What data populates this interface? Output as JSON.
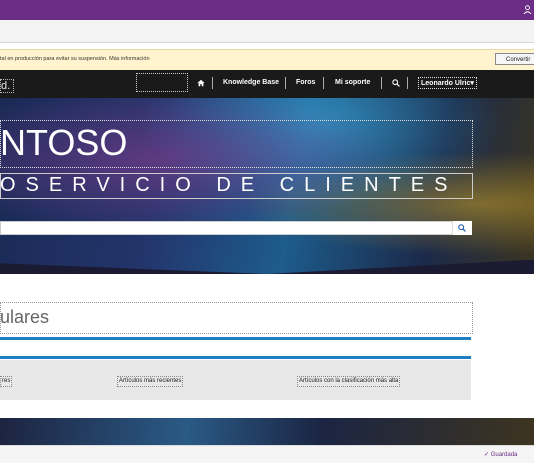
{
  "warning": {
    "message": "tal en producción para evitar su suspensión. Más información",
    "button_label": "Convertir"
  },
  "nav": {
    "logo_text": "d.",
    "items": [
      "Knowledge Base",
      "Foros",
      "Mi soporte"
    ],
    "user_label": "Leonardo Ulric▾"
  },
  "hero": {
    "title": "NTOSO",
    "subtitle": "OSERVICIO DE CLIENTES",
    "search_placeholder": ""
  },
  "section": {
    "title": "ulares",
    "tabs": [
      "res",
      "Artículos más recientes",
      "Artículos con la clasificación más alta"
    ]
  },
  "status": {
    "saved_label": "✓  Guardada"
  },
  "colors": {
    "brand_purple": "#6b2d86",
    "accent_blue": "#1f7dc2",
    "nav_dark": "#1a1a1a"
  },
  "icons": [
    "person-icon",
    "home-icon",
    "search-icon",
    "search-button-icon"
  ]
}
